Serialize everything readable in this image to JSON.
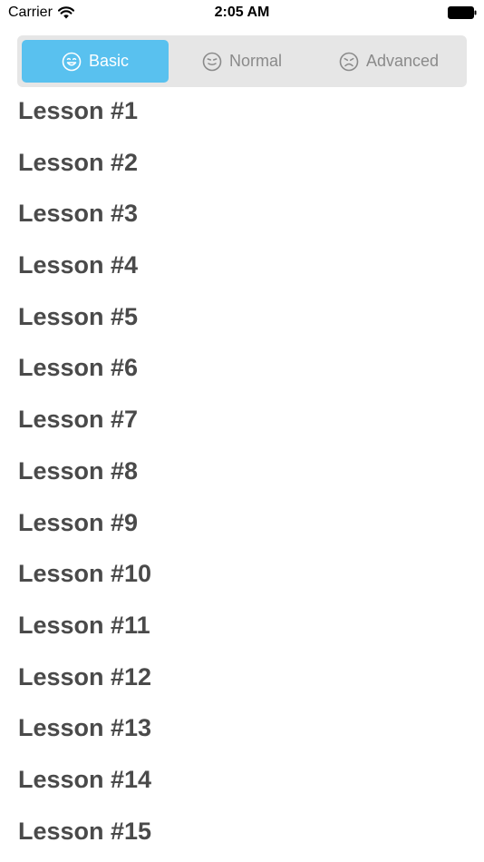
{
  "status_bar": {
    "carrier": "Carrier",
    "time": "2:05 AM"
  },
  "segments": [
    {
      "label": "Basic",
      "icon": "smile-face-icon",
      "active": true
    },
    {
      "label": "Normal",
      "icon": "neutral-face-icon",
      "active": false
    },
    {
      "label": "Advanced",
      "icon": "frown-face-icon",
      "active": false
    }
  ],
  "lessons": [
    "Lesson #1",
    "Lesson #2",
    "Lesson #3",
    "Lesson #4",
    "Lesson #5",
    "Lesson #6",
    "Lesson #7",
    "Lesson #8",
    "Lesson #9",
    "Lesson #10",
    "Lesson #11",
    "Lesson #12",
    "Lesson #13",
    "Lesson #14",
    "Lesson #15"
  ],
  "colors": {
    "accent": "#59c1ef",
    "segment_bg": "#e6e6e6",
    "lesson_text": "#4a4a4a",
    "inactive_text": "#8a8a8a"
  }
}
